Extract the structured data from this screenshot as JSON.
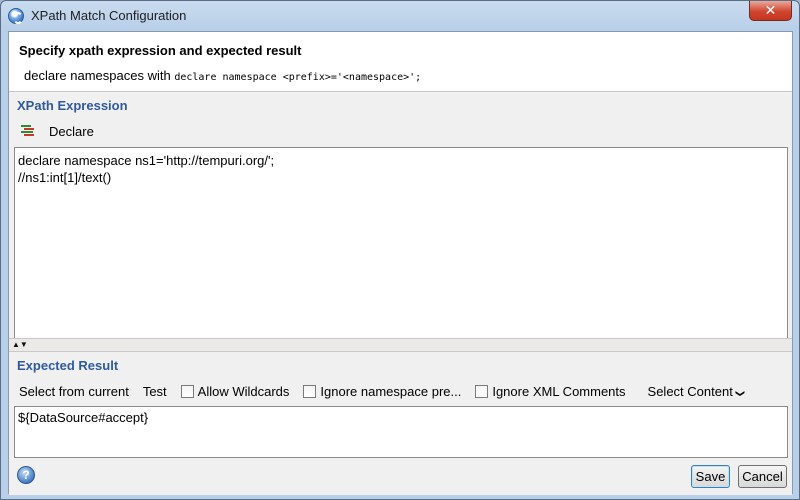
{
  "window": {
    "title": "XPath Match Configuration",
    "close_glyph": "✕"
  },
  "header": {
    "title": "Specify xpath expression and expected result",
    "desc_prefix": "declare namespaces with",
    "desc_code": "declare namespace <prefix>='<namespace>';"
  },
  "xpath": {
    "section_title": "XPath Expression",
    "declare_label": "Declare",
    "expression": "declare namespace ns1='http://tempuri.org/';\n//ns1:int[1]/text()"
  },
  "splitter": {
    "arrows": "▲▼"
  },
  "expected": {
    "section_title": "Expected Result",
    "select_from_current": "Select from current",
    "test": "Test",
    "allow_wildcards": "Allow Wildcards",
    "ignore_namespace": "Ignore namespace pre...",
    "ignore_xml_comments": "Ignore XML Comments",
    "select_content": "Select Content",
    "select_content_chevron": "❯",
    "value": "${DataSource#accept}"
  },
  "footer": {
    "help_glyph": "?",
    "save_label": "Save",
    "cancel_label": "Cancel"
  },
  "icons": {
    "app": "soapui-app-icon",
    "close": "close-icon",
    "declare": "declare-namespace-icon",
    "help": "help-icon"
  }
}
